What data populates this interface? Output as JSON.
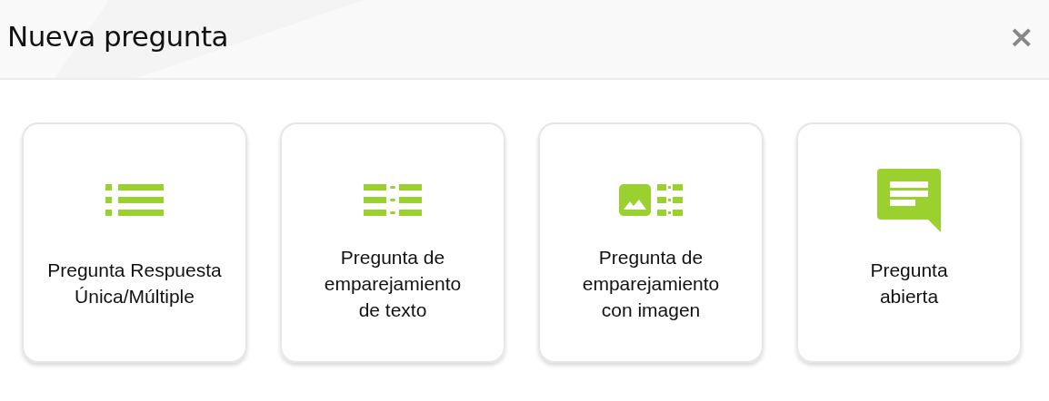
{
  "dialog": {
    "title": "Nueva pregunta",
    "close": "×"
  },
  "options": [
    {
      "kind": "single-multiple",
      "label": "Pregunta Respuesta\nÚnica/Múltiple"
    },
    {
      "kind": "text-matching",
      "label": "Pregunta de\nemparejamiento\nde texto"
    },
    {
      "kind": "image-matching",
      "label": "Pregunta de\nemparejamiento\ncon imagen"
    },
    {
      "kind": "open",
      "label": "Pregunta\nabierta"
    }
  ]
}
